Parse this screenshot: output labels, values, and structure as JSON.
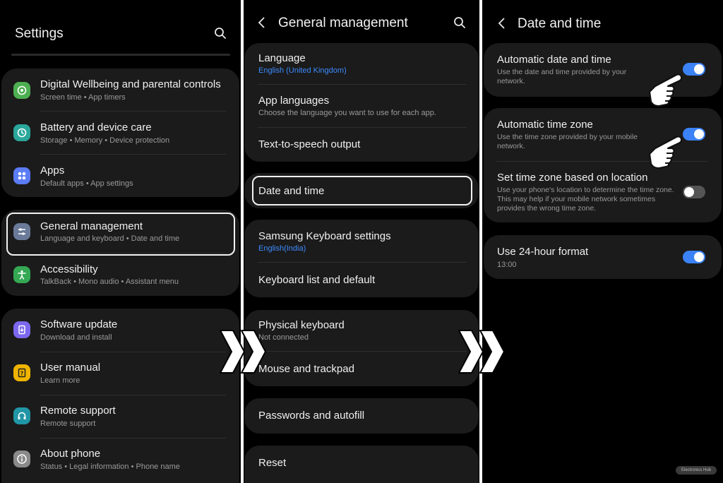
{
  "settings": {
    "title": "Settings",
    "items": [
      {
        "title": "Digital Wellbeing and parental controls",
        "sub": "Screen time  •  App timers"
      },
      {
        "title": "Battery and device care",
        "sub": "Storage  •  Memory  •  Device protection"
      },
      {
        "title": "Apps",
        "sub": "Default apps  •  App settings"
      },
      {
        "title": "General management",
        "sub": "Language and keyboard  •  Date and time"
      },
      {
        "title": "Accessibility",
        "sub": "TalkBack  •  Mono audio  •  Assistant menu"
      },
      {
        "title": "Software update",
        "sub": "Download and install"
      },
      {
        "title": "User manual",
        "sub": "Learn more"
      },
      {
        "title": "Remote support",
        "sub": "Remote support"
      },
      {
        "title": "About phone",
        "sub": "Status  •  Legal information  •  Phone name"
      }
    ]
  },
  "general": {
    "title": "General management",
    "items": [
      {
        "title": "Language",
        "sub": "English (United Kingdom)"
      },
      {
        "title": "App languages",
        "sub": "Choose the language you want to use for each app."
      },
      {
        "title": "Text-to-speech output"
      },
      {
        "title": "Date and time"
      },
      {
        "title": "Samsung Keyboard settings",
        "sub": "English(India)"
      },
      {
        "title": "Keyboard list and default"
      },
      {
        "title": "Physical keyboard",
        "sub": "Not connected"
      },
      {
        "title": "Mouse and trackpad"
      },
      {
        "title": "Passwords and autofill"
      },
      {
        "title": "Reset"
      }
    ]
  },
  "datetime": {
    "title": "Date and time",
    "items": [
      {
        "title": "Automatic date and time",
        "desc": "Use the date and time provided by your network.",
        "enabled": true
      },
      {
        "title": "Automatic time zone",
        "desc": "Use the time zone provided by your mobile network.",
        "enabled": true
      },
      {
        "title": "Set time zone based on location",
        "desc": "Use your phone's location to determine the time zone. This may help if your mobile network sometimes provides the wrong time zone.",
        "enabled": false
      },
      {
        "title": "Use 24-hour format",
        "sub": "13:00",
        "enabled": true
      }
    ]
  },
  "icons": {
    "colors": {
      "wellbeing": "#4caf50",
      "battery": "#2aa79b",
      "apps": "#5b7cf5",
      "general": "#6b7a99",
      "accessibility": "#34a853",
      "software": "#7b68ee",
      "manual": "#f0b400",
      "remote": "#2196a6",
      "about": "#8a8a8a"
    }
  },
  "watermark": "Electronics Hub",
  "accent": "#3b82f6"
}
